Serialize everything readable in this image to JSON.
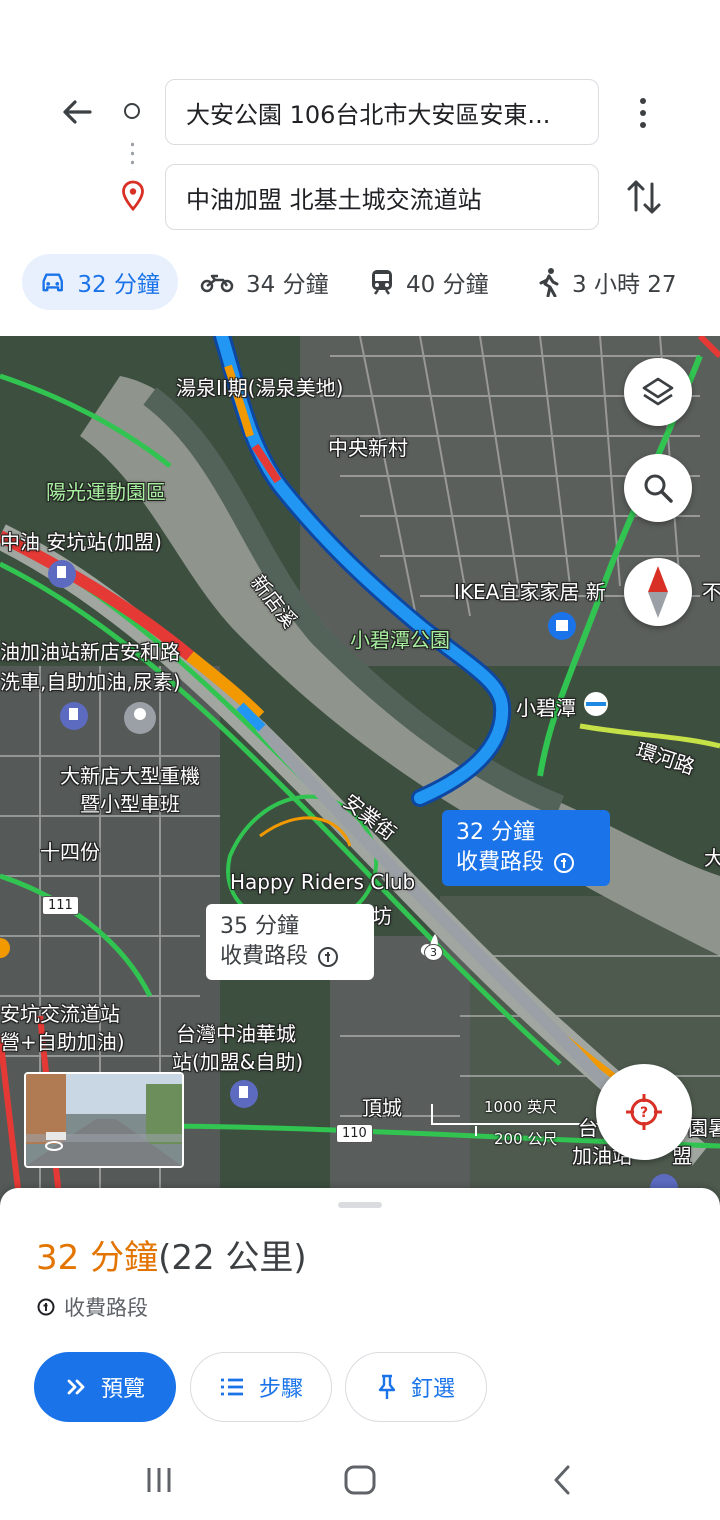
{
  "search": {
    "origin": "大安公園 106台北市大安區安東...",
    "destination": "中油加盟 北基土城交流道站"
  },
  "modes": [
    {
      "icon": "car-icon",
      "label": "32 分鐘",
      "active": true
    },
    {
      "icon": "motorcycle-icon",
      "label": "34 分鐘"
    },
    {
      "icon": "train-icon",
      "label": "40 分鐘"
    },
    {
      "icon": "walk-icon",
      "label": "3 小時 27"
    }
  ],
  "map": {
    "labels": {
      "l1": "湯泉II期(湯泉美地)",
      "l2": "中央新村",
      "l3": "陽光運動園區",
      "l4": "中油 安坑站(加盟)",
      "l5": "新店溪",
      "l6": "小碧潭公園",
      "l7": "IKEA宜家家居 新",
      "l8": "不",
      "l9": "油加油站新店安和路",
      "l10": "洗車,自助加油,尿素)",
      "l11": "小碧潭",
      "l12": "環河路",
      "l13": "大新店大型重機",
      "l14": "暨小型車班",
      "l15": "安業街",
      "l16": "十四份",
      "l17": "Happy Riders Club",
      "l18": "坊",
      "l19": "大",
      "l20": "安坑交流道站",
      "l21": "營+自助加油)",
      "l22": "台灣中油華城",
      "l23": "站(加盟&自助)",
      "l24": "頂城",
      "l25": "台",
      "l26": "加油站",
      "l27": "盟",
      "l28": "園暑"
    },
    "shields": {
      "s111": "111",
      "s110": "110",
      "s3": "3"
    },
    "scale": {
      "imperial": "1000 英尺",
      "metric": "200 公尺"
    },
    "callout_primary": {
      "time": "32 分鐘",
      "note": "收費路段"
    },
    "callout_alt": {
      "time": "35 分鐘",
      "note": "收費路段"
    }
  },
  "sheet": {
    "time": "32 分鐘",
    "distance": "(22 公里)",
    "toll": "收費路段",
    "buttons": {
      "preview": "預覽",
      "steps": "步驟",
      "pin": "釘選"
    }
  },
  "colors": {
    "accent": "#1a73e8",
    "duration": "#e37400",
    "route": "#2196f3"
  }
}
